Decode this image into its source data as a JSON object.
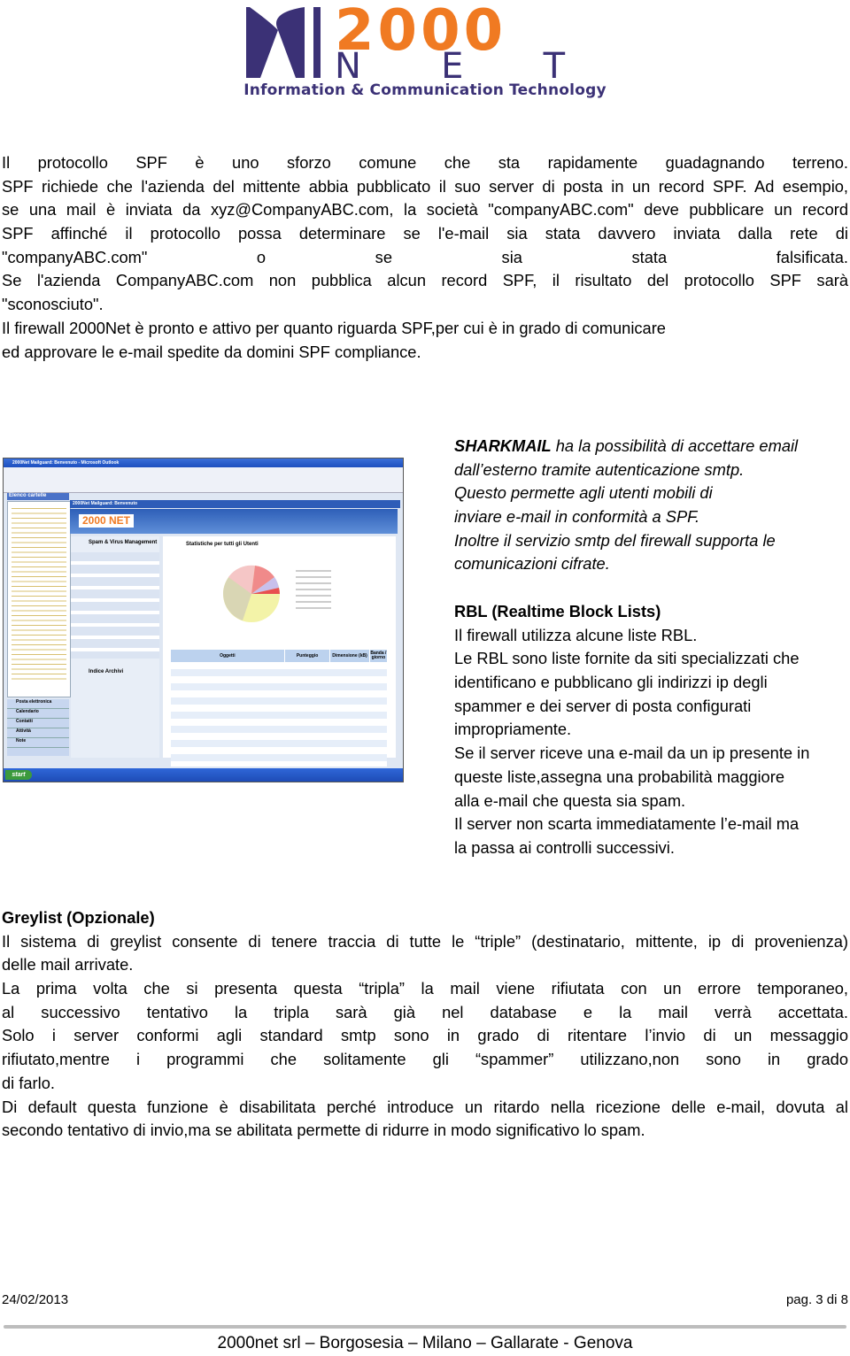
{
  "header": {
    "logo_text": "2000 NET",
    "logo_tagline": "Information & Communication Technology",
    "colors": {
      "orange": "#f07a22",
      "purple": "#3b3176"
    }
  },
  "intro": {
    "lines": [
      "Il protocollo SPF è uno sforzo comune che sta rapidamente guadagnando terreno.",
      "SPF richiede che l'azienda del mittente abbia pubblicato il suo server di posta in un record SPF. Ad esempio,",
      "se una mail è inviata da xyz@CompanyABC.com, la società \"companyABC.com\" deve pubblicare un record",
      "SPF affinché il protocollo possa determinare se l'e-mail sia stata davvero inviata dalla rete di",
      "\"companyABC.com\" o se sia stata falsificata.",
      "Se l'azienda CompanyABC.com non pubblica alcun record SPF, il risultato del protocollo SPF sarà",
      "\"sconosciuto\".",
      "Il firewall 2000Net è pronto e attivo per quanto riguarda SPF,per cui è in grado di comunicare",
      "ed approvare le e-mail spedite da domini SPF compliance."
    ]
  },
  "sharkmail": {
    "brand": "SHARKMAIL",
    "first_rest": " ha la possibilità di accettare email",
    "lines": [
      "dall’esterno tramite autenticazione smtp.",
      "Questo permette agli utenti mobili di",
      "inviare e-mail in conformità a SPF.",
      "Inoltre il servizio smtp del firewall supporta le",
      "comunicazioni cifrate."
    ]
  },
  "rbl": {
    "title": "RBL (Realtime Block Lists)",
    "lines": [
      "Il firewall utilizza alcune liste RBL.",
      "Le RBL sono liste fornite da siti specializzati che",
      "identificano e pubblicano gli indirizzi ip degli",
      "spammer e dei server di posta configurati",
      "impropriamente.",
      "Se il server riceve una e-mail da un ip presente in",
      "queste liste,assegna una probabilità maggiore",
      "alla e-mail che questa sia spam.",
      "Il server non scarta immediatamente l’e-mail ma",
      "la passa ai controlli successivi."
    ]
  },
  "greylist": {
    "title": "Greylist (Opzionale)",
    "lines": [
      "Il sistema di greylist consente di tenere traccia di tutte le “triple” (destinatario, mittente, ip di provenienza)",
      "delle mail arrivate.",
      "La prima volta che si presenta questa “tripla” la mail viene rifiutata con un errore temporaneo,",
      "al successivo tentativo la tripla sarà già nel database e la mail verrà accettata.",
      "Solo i server conformi agli standard smtp sono in grado di ritentare l’invio di un messaggio",
      "rifiutato,mentre i programmi che solitamente gli “spammer” utilizzano,non sono in grado",
      "di farlo.",
      "Di default questa funzione è disabilitata perché introduce un ritardo nella ricezione delle e-mail, dovuta al",
      "secondo tentativo di invio,ma se abilitata permette di ridurre in modo significativo lo spam."
    ]
  },
  "screenshot": {
    "window_title": "2000Net Mailguard: Benvenuto - Microsoft Outlook",
    "folder_pane_title": "Elenco cartelle",
    "content_title": "2000Net Mailguard: Benvenuto",
    "spam_panel": "Spam & Virus Management",
    "stats_title": "Statistiche per tutti gli Utenti",
    "archive_title": "Indice Archivi",
    "nav": [
      "Posta elettronica",
      "Calendario",
      "Contatti",
      "Attività",
      "Note"
    ],
    "start": "start",
    "table_headers": [
      "Oggetti",
      "Punteggio",
      "Dimensione (kB)",
      "Banda / giorno"
    ],
    "pie_colors": [
      "#f3f3a8",
      "#d9d6b4",
      "#f5c6c6",
      "#f08a8a",
      "#c8c0ec",
      "#e85050"
    ]
  },
  "footer": {
    "date": "24/02/2013",
    "page": "pag. 3 di 8",
    "company": "2000net srl – Borgosesia – Milano – Gallarate - Genova"
  }
}
